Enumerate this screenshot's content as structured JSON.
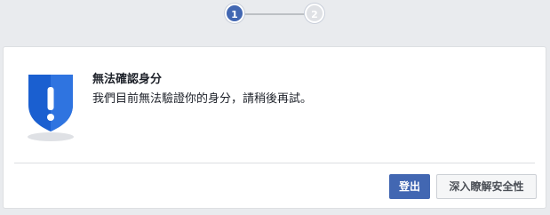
{
  "stepper": {
    "steps": [
      {
        "label": "1",
        "active": true
      },
      {
        "label": "2",
        "active": false
      }
    ]
  },
  "dialog": {
    "icon": "shield-alert-icon",
    "title": "無法確認身分",
    "message": "我們目前無法驗證你的身分，請稍後再試。",
    "buttons": {
      "logout_label": "登出",
      "learn_more_label": "深入瞭解安全性"
    }
  },
  "colors": {
    "primary": "#4267b2",
    "shield_blue": "#1a5fd0",
    "background": "#e9ebee"
  }
}
